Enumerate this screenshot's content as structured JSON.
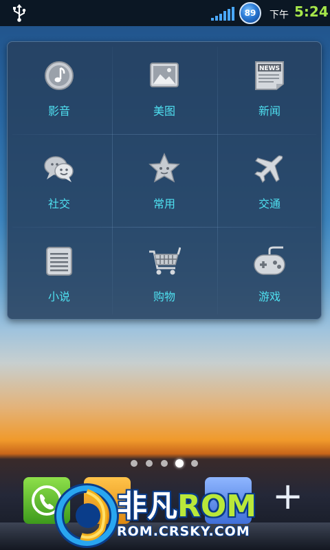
{
  "status_bar": {
    "usb_icon": "usb-icon",
    "signal_icon": "signal-bars-icon",
    "battery_level": "89",
    "ampm": "下午",
    "time": "5:24"
  },
  "folder": {
    "apps": [
      {
        "label": "影音",
        "icon": "music-note-icon"
      },
      {
        "label": "美图",
        "icon": "picture-icon"
      },
      {
        "label": "新闻",
        "icon": "news-icon",
        "icon_text": "NEWS"
      },
      {
        "label": "社交",
        "icon": "chat-bubbles-icon"
      },
      {
        "label": "常用",
        "icon": "star-icon"
      },
      {
        "label": "交通",
        "icon": "airplane-icon"
      },
      {
        "label": "小说",
        "icon": "book-list-icon"
      },
      {
        "label": "购物",
        "icon": "shopping-cart-icon"
      },
      {
        "label": "游戏",
        "icon": "gamepad-icon"
      }
    ],
    "label_color": "#4fe0f0"
  },
  "pager": {
    "pages": 5,
    "current": 4
  },
  "watermark": {
    "brand": "非凡",
    "rom": "ROM",
    "plus": "+",
    "url": "ROM.CRSKY.COM"
  }
}
